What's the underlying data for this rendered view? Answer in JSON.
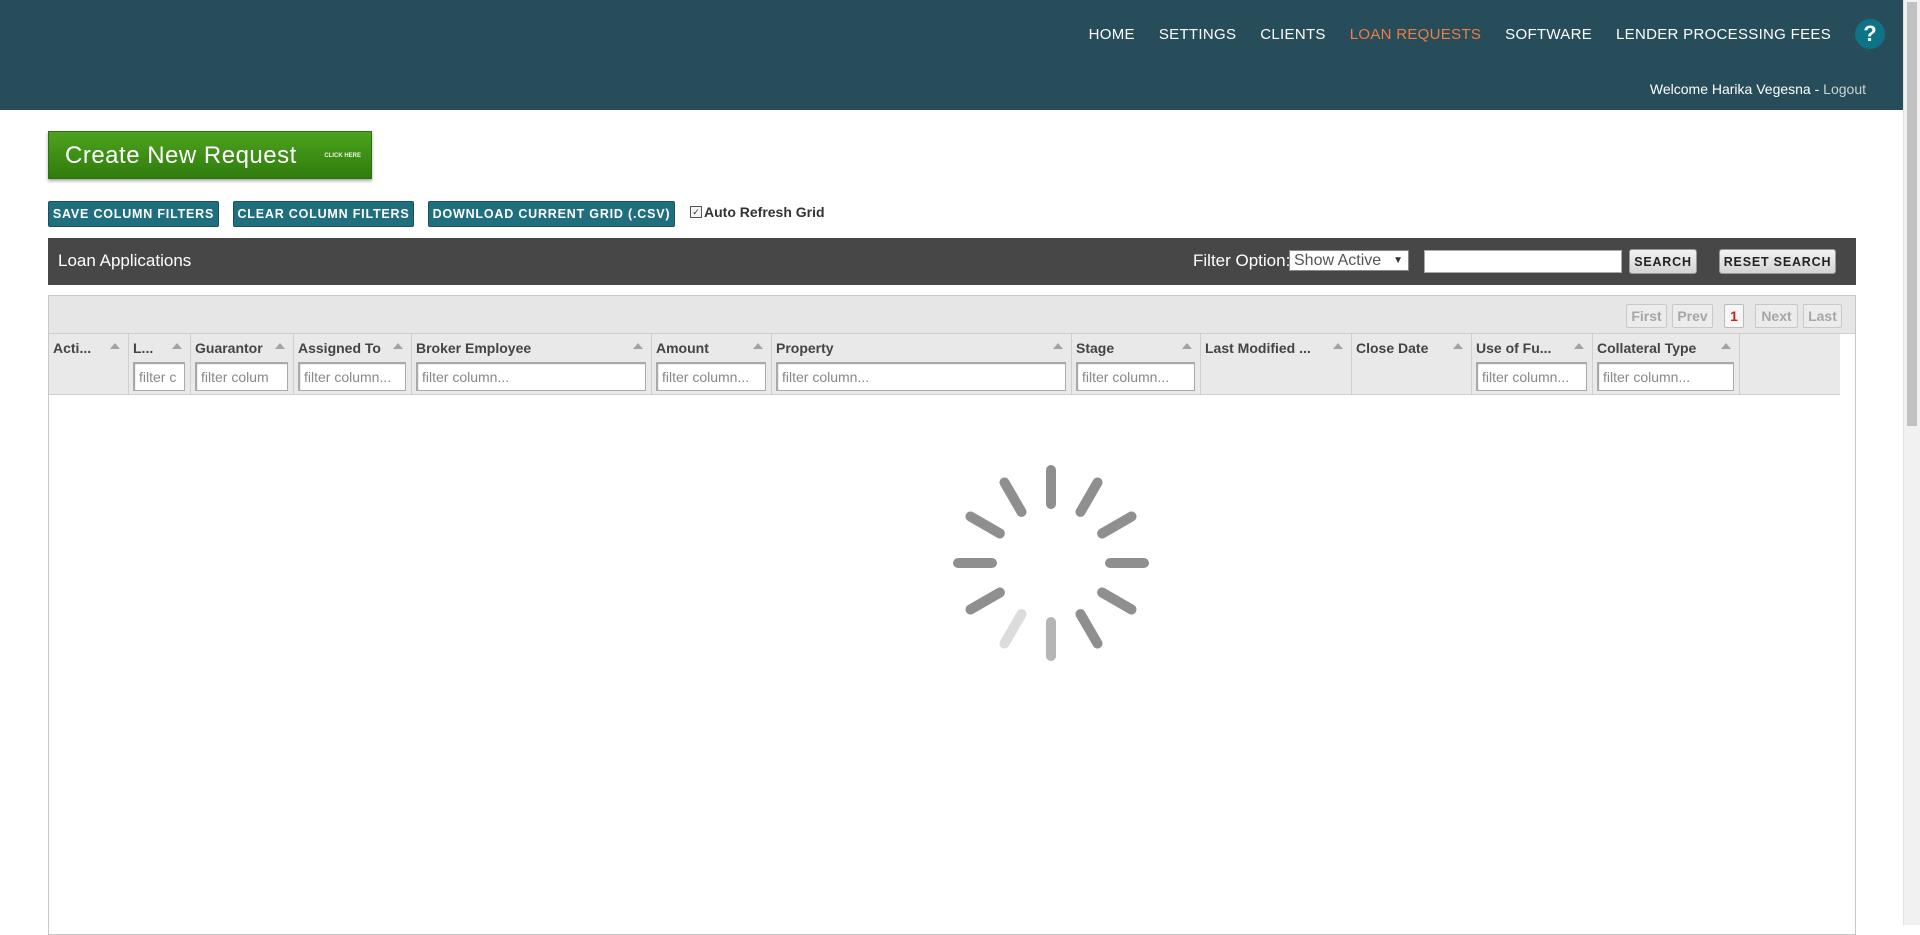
{
  "nav": {
    "items": [
      {
        "label": "HOME",
        "active": false
      },
      {
        "label": "SETTINGS",
        "active": false
      },
      {
        "label": "CLIENTS",
        "active": false
      },
      {
        "label": "LOAN REQUESTS",
        "active": true
      },
      {
        "label": "SOFTWARE",
        "active": false
      },
      {
        "label": "LENDER PROCESSING FEES",
        "active": false
      }
    ],
    "help_label": "?",
    "active_color": "#ef7d47"
  },
  "user": {
    "welcome": "Welcome Harika Vegesna",
    "separator": " - ",
    "logout": "Logout"
  },
  "create_button": {
    "label": "Create New Request",
    "sub_label": "CLICK HERE"
  },
  "toolbar": {
    "save_filters": "SAVE COLUMN FILTERS",
    "clear_filters": "CLEAR COLUMN FILTERS",
    "download_csv": "DOWNLOAD CURRENT GRID (.CSV)",
    "auto_refresh_label": "Auto Refresh Grid",
    "auto_refresh_checked": true
  },
  "grid_bar": {
    "title": "Loan Applications",
    "filter_label": "Filter Option:",
    "filter_value": "Show Active",
    "search_value": "",
    "search_button": "SEARCH",
    "reset_button": "RESET SEARCH"
  },
  "pager": {
    "first": "First",
    "prev": "Prev",
    "current_page": "1",
    "next": "Next",
    "last": "Last"
  },
  "columns": [
    {
      "title": "Acti...",
      "filter": null
    },
    {
      "title": "L...",
      "filter": "filter c"
    },
    {
      "title": "Guarantor",
      "filter": "filter colum"
    },
    {
      "title": "Assigned To",
      "filter": "filter column..."
    },
    {
      "title": "Broker Employee",
      "filter": "filter column..."
    },
    {
      "title": "Amount",
      "filter": "filter column..."
    },
    {
      "title": "Property",
      "filter": "filter column..."
    },
    {
      "title": "Stage",
      "filter": "filter column..."
    },
    {
      "title": "Last Modified ...",
      "filter": null
    },
    {
      "title": "Close Date",
      "filter": null
    },
    {
      "title": "Use of Fu...",
      "filter": "filter column..."
    },
    {
      "title": "Collateral Type",
      "filter": "filter column..."
    }
  ],
  "colors": {
    "header_bg": "#264d59",
    "action_button": "#1f6f7f",
    "create_button": "#3f961a",
    "grid_bar": "#474747"
  },
  "loading": true
}
